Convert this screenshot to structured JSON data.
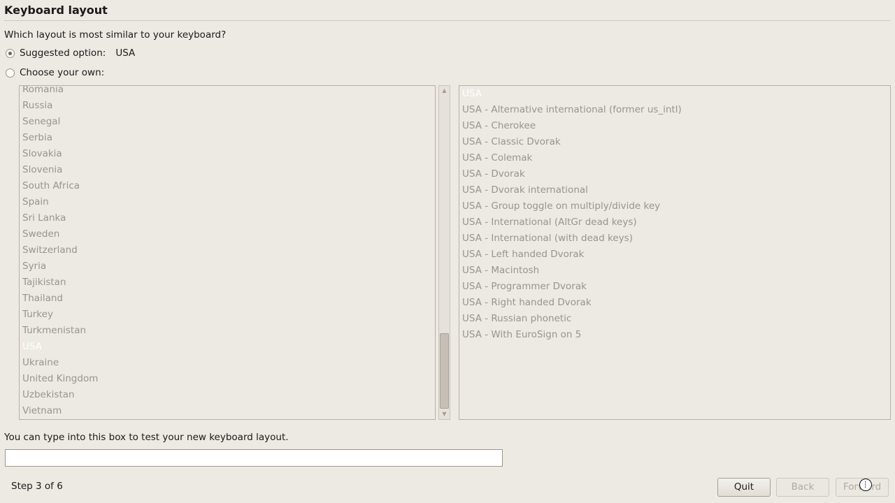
{
  "header": {
    "title": "Keyboard layout",
    "question": "Which layout is most similar to your keyboard?"
  },
  "options": {
    "suggested_label": "Suggested option:",
    "suggested_value": "USA",
    "choose_label": "Choose your own:"
  },
  "countries": [
    "Romania",
    "Russia",
    "Senegal",
    "Serbia",
    "Slovakia",
    "Slovenia",
    "South Africa",
    "Spain",
    "Sri Lanka",
    "Sweden",
    "Switzerland",
    "Syria",
    "Tajikistan",
    "Thailand",
    "Turkey",
    "Turkmenistan",
    "USA",
    "Ukraine",
    "United Kingdom",
    "Uzbekistan",
    "Vietnam"
  ],
  "selected_country": "USA",
  "variants": [
    "USA",
    "USA - Alternative international (former us_intl)",
    "USA - Cherokee",
    "USA - Classic Dvorak",
    "USA - Colemak",
    "USA - Dvorak",
    "USA - Dvorak international",
    "USA - Group toggle on multiply/divide key",
    "USA - International (AltGr dead keys)",
    "USA - International (with dead keys)",
    "USA - Left handed Dvorak",
    "USA - Macintosh",
    "USA - Programmer Dvorak",
    "USA - Right handed Dvorak",
    "USA - Russian phonetic",
    "USA - With EuroSign on 5"
  ],
  "selected_variant": "USA",
  "test": {
    "label": "You can type into this box to test your new keyboard layout.",
    "value": ""
  },
  "footer": {
    "step": "Step 3 of 6",
    "quit_label": "Quit",
    "back_label": "Back",
    "forward_label": "Forward"
  }
}
